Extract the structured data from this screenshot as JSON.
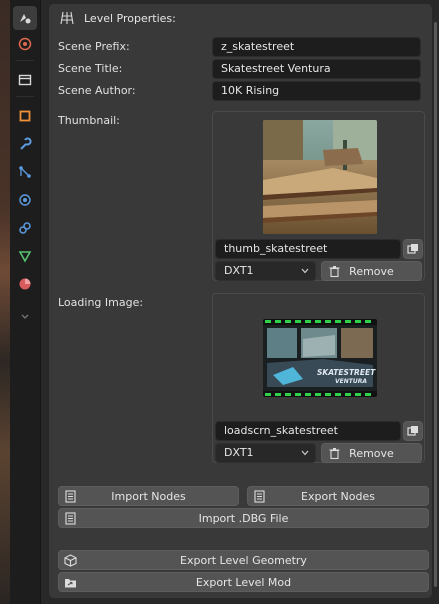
{
  "panel": {
    "title": "Level Properties:"
  },
  "fields": {
    "scene_prefix": {
      "label": "Scene Prefix:",
      "value": "z_skatestreet"
    },
    "scene_title": {
      "label": "Scene Title:",
      "value": "Skatestreet Ventura"
    },
    "scene_author": {
      "label": "Scene Author:",
      "value": "10K Rising"
    }
  },
  "thumbnail": {
    "label": "Thumbnail:",
    "image_name": "thumb_skatestreet",
    "format": "DXT1",
    "remove_label": "Remove"
  },
  "loading_image": {
    "label": "Loading Image:",
    "image_name": "loadscrn_skatestreet",
    "format": "DXT1",
    "remove_label": "Remove",
    "logo_line1": "SKATESTREET",
    "logo_line2": "VENTURA"
  },
  "buttons": {
    "import_nodes": "Import Nodes",
    "export_nodes": "Export Nodes",
    "import_dbg": "Import .DBG File",
    "export_geometry": "Export Level Geometry",
    "export_mod": "Export Level Mod"
  },
  "tabs": [
    "tool",
    "render",
    "output",
    "view-layer",
    "scene",
    "world",
    "object",
    "modifiers",
    "particles",
    "physics",
    "constraints",
    "data",
    "material",
    "more"
  ],
  "colors": {
    "accent": "#4772b3",
    "panel": "#393939",
    "button": "#545454",
    "field": "#1d1d1d"
  }
}
